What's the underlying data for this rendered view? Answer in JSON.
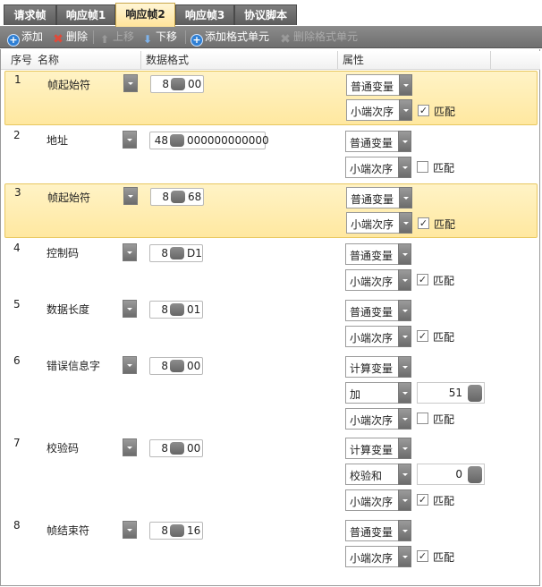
{
  "tabs": [
    "请求帧",
    "响应帧1",
    "响应帧2",
    "响应帧3",
    "协议脚本"
  ],
  "toolbar": {
    "add": "添加",
    "delete": "删除",
    "move_up": "上移",
    "move_down": "下移",
    "add_unit": "添加格式单元",
    "del_unit": "删除格式单元"
  },
  "columns": {
    "seq": "序号",
    "name": "名称",
    "format": "数据格式",
    "attr": "属性"
  },
  "rows": [
    {
      "num": "1",
      "name": "帧起始符",
      "len": "8",
      "value": "00",
      "type": "普通变量",
      "order": "小端次序",
      "match": true
    },
    {
      "num": "2",
      "name": "地址",
      "len": "48",
      "value": "000000000000",
      "type": "普通变量",
      "order": "小端次序",
      "match": false
    },
    {
      "num": "3",
      "name": "帧起始符",
      "len": "8",
      "value": "68",
      "type": "普通变量",
      "order": "小端次序",
      "match": true
    },
    {
      "num": "4",
      "name": "控制码",
      "len": "8",
      "value": "D1",
      "type": "普通变量",
      "order": "小端次序",
      "match": true
    },
    {
      "num": "5",
      "name": "数据长度",
      "len": "8",
      "value": "01",
      "type": "普通变量",
      "order": "小端次序",
      "match": true
    },
    {
      "num": "6",
      "name": "错误信息字",
      "len": "8",
      "value": "00",
      "type": "计算变量",
      "calc": "加",
      "calc_value": "51",
      "order": "小端次序",
      "match": false
    },
    {
      "num": "7",
      "name": "校验码",
      "len": "8",
      "value": "00",
      "type": "计算变量",
      "calc": "校验和",
      "calc_value": "0",
      "order": "小端次序",
      "match": true
    },
    {
      "num": "8",
      "name": "帧结束符",
      "len": "8",
      "value": "16",
      "type": "普通变量",
      "order": "小端次序",
      "match": true
    }
  ],
  "match_label": "匹配",
  "check_mark": "✓",
  "icons": {
    "add": "plus-circle-icon",
    "delete": "red-x-icon",
    "up": "arrow-up-icon",
    "down": "arrow-down-icon"
  },
  "colors": {
    "selected_row": "#ffe8a0",
    "active_tab": "#ffe39a",
    "toolbar": "#7a7a7a"
  }
}
